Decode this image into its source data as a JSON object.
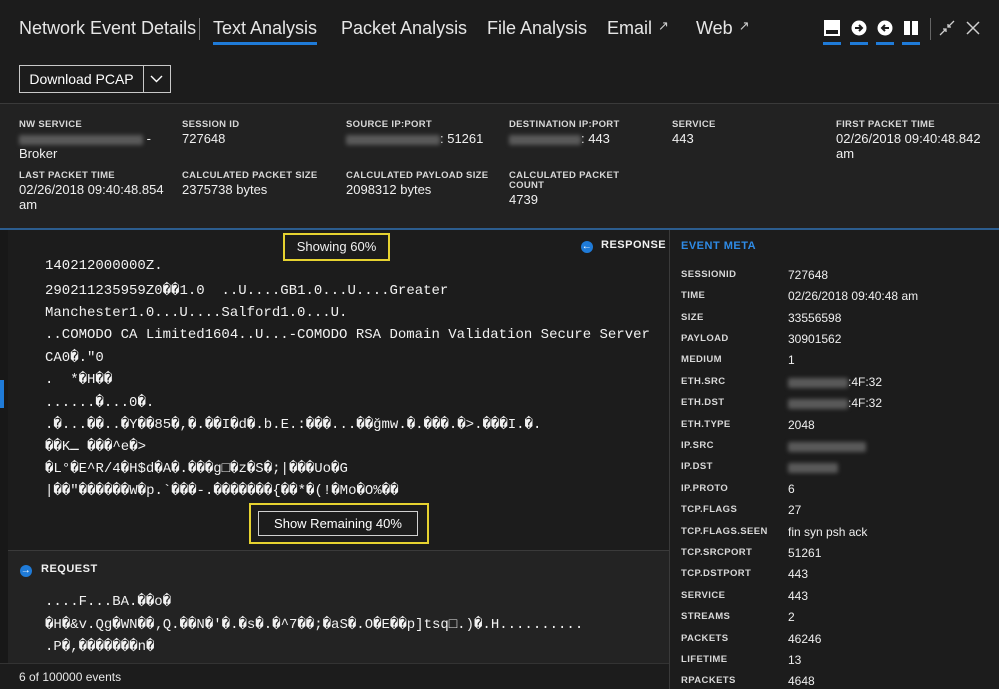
{
  "tabs": {
    "network_event_details": "Network Event Details",
    "text_analysis": "Text Analysis",
    "packet_analysis": "Packet Analysis",
    "file_analysis": "File Analysis",
    "email": "Email",
    "web": "Web"
  },
  "toolbar": {
    "download_label": "Download PCAP",
    "icons": [
      "panel-top-icon",
      "arrow-right-circle-icon",
      "arrow-left-circle-icon",
      "split-view-icon",
      "collapse-icon",
      "close-icon"
    ]
  },
  "info": {
    "nw_service": {
      "label": "NW SERVICE",
      "value_suffix": "-",
      "value_line2": "Broker"
    },
    "session_id": {
      "label": "SESSION ID",
      "value": "727648"
    },
    "source_ip_port": {
      "label": "SOURCE IP:PORT",
      "value_port": ": 51261"
    },
    "destination_ip_port": {
      "label": "DESTINATION IP:PORT",
      "value_port": ": 443"
    },
    "service": {
      "label": "SERVICE",
      "value": "443"
    },
    "first_packet_time": {
      "label": "FIRST PACKET TIME",
      "value_line1": "02/26/2018 09:40:48.842",
      "value_line2": "am"
    },
    "last_packet_time": {
      "label": "LAST PACKET TIME",
      "value_line1": "02/26/2018 09:40:48.854",
      "value_line2": "am"
    },
    "calc_packet_size": {
      "label": "CALCULATED PACKET SIZE",
      "value": "2375738 bytes"
    },
    "calc_payload_size": {
      "label": "CALCULATED PAYLOAD SIZE",
      "value": "2098312 bytes"
    },
    "calc_packet_count": {
      "label_line1": "CALCULATED PACKET",
      "label_line2": "COUNT",
      "value": "4739"
    }
  },
  "response": {
    "showing_label": "Showing 60%",
    "header": "RESPONSE",
    "lines": [
      "140212000000Z.",
      "290211235959Z0��1.0  ..U....GB1.0...U....Greater",
      "Manchester1.0...U....Salford1.0...U.",
      "..COMODO CA Limited1604..U...-COMODO RSA Domain Validation Secure Server",
      "CA0�.\"0",
      ".  *�H��",
      "......�...0�.",
      ".�...��..�Y��85�,�.��I�d�.b.E.:���...��ğmw.�.���.�>.���I.�.",
      "��Kـ ���^e�>",
      "�L°�E^R/4�H$d�A�.���g□�z�S�;|���Uo�G",
      "|��\"������W�p.`���-.�������{��*�(!�Mo�O%��"
    ],
    "show_remaining_label": "Show Remaining 40%"
  },
  "request": {
    "header": "REQUEST",
    "lines": [
      "....F...BA.��o�",
      "�H�&v.Qg�WN��‚Q.��N�'�.�s�.�^7��;�aS�.O�E��p]tsq□.)�.H..........",
      ".P�,�������n�"
    ]
  },
  "event_meta": {
    "title": "EVENT META",
    "rows": [
      {
        "key": "SESSIONID",
        "value": "727648"
      },
      {
        "key": "TIME",
        "value": "02/26/2018 09:40:48 am"
      },
      {
        "key": "SIZE",
        "value": "33556598"
      },
      {
        "key": "PAYLOAD",
        "value": "30901562"
      },
      {
        "key": "MEDIUM",
        "value": "1"
      },
      {
        "key": "ETH.SRC",
        "value": ":4F:32"
      },
      {
        "key": "ETH.DST",
        "value": ":4F:32"
      },
      {
        "key": "ETH.TYPE",
        "value": "2048"
      },
      {
        "key": "IP.SRC",
        "value": ""
      },
      {
        "key": "IP.DST",
        "value": ""
      },
      {
        "key": "IP.PROTO",
        "value": "6"
      },
      {
        "key": "TCP.FLAGS",
        "value": "27"
      },
      {
        "key": "TCP.FLAGS.SEEN",
        "value": "fin syn psh ack"
      },
      {
        "key": "TCP.SRCPORT",
        "value": "51261"
      },
      {
        "key": "TCP.DSTPORT",
        "value": "443"
      },
      {
        "key": "SERVICE",
        "value": "443"
      },
      {
        "key": "STREAMS",
        "value": "2"
      },
      {
        "key": "PACKETS",
        "value": "46246"
      },
      {
        "key": "LIFETIME",
        "value": "13"
      },
      {
        "key": "RPACKETS",
        "value": "4648"
      }
    ]
  },
  "status": {
    "events": "6 of 100000 events"
  },
  "colors": {
    "accent": "#1f7bd8",
    "highlight": "#e6d230",
    "background": "#1c1c1c"
  }
}
